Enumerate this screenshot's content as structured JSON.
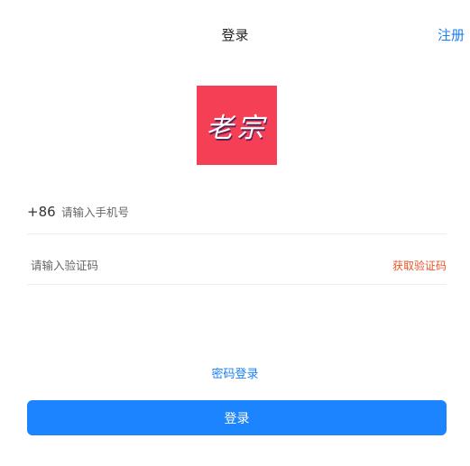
{
  "header": {
    "title": "登录",
    "register_label": "注册"
  },
  "logo": {
    "text": "老宗",
    "background_color": "#f53f55"
  },
  "form": {
    "country_code": "+86",
    "phone_placeholder": "请输入手机号",
    "phone_value": "",
    "code_placeholder": "请输入验证码",
    "code_value": "",
    "get_code_label": "获取验证码"
  },
  "password_login_label": "密码登录",
  "login_button_label": "登录",
  "colors": {
    "accent": "#1b84fe",
    "link": "#1a7ff0",
    "get_code": "#e9562b"
  }
}
